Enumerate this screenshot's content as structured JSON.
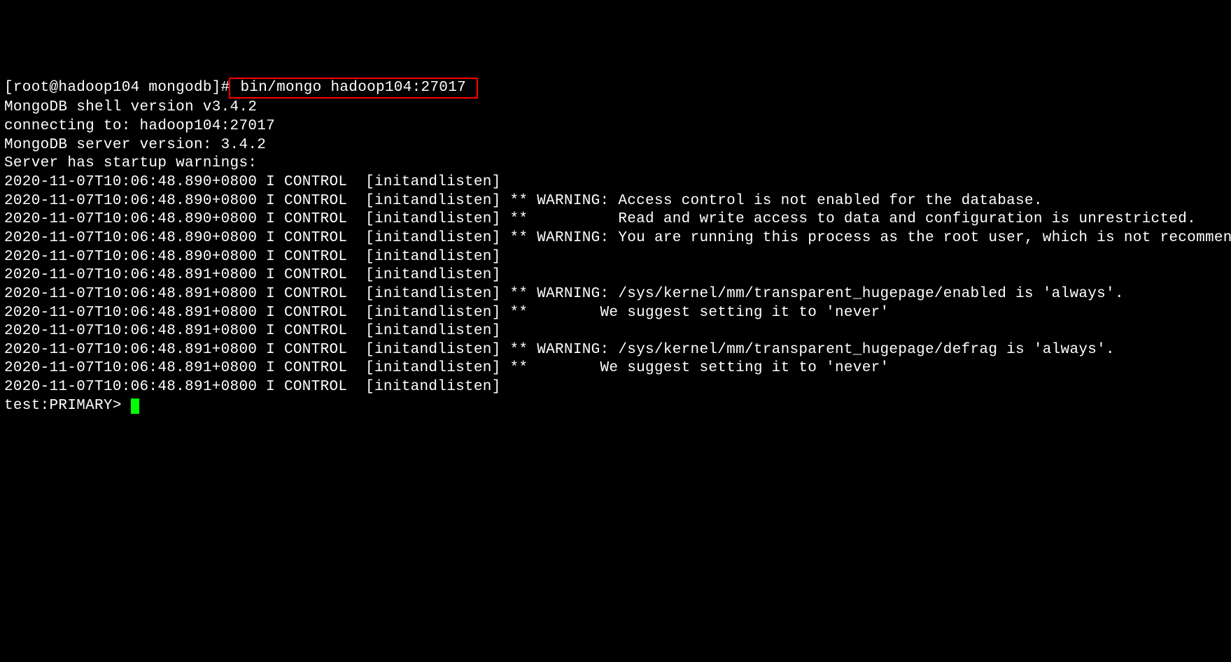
{
  "prompt_prefix": "[root@hadoop104 mongodb]#",
  "command": " bin/mongo hadoop104:27017 ",
  "lines": {
    "l1": "MongoDB shell version v3.4.2",
    "l2": "connecting to: hadoop104:27017",
    "l3": "MongoDB server version: 3.4.2",
    "l4": "Server has startup warnings: ",
    "l5": "2020-11-07T10:06:48.890+0800 I CONTROL  [initandlisten] ",
    "l6": "2020-11-07T10:06:48.890+0800 I CONTROL  [initandlisten] ** WARNING: Access control is not enabled for the database.",
    "l7": "2020-11-07T10:06:48.890+0800 I CONTROL  [initandlisten] **          Read and write access to data and configuration is unrestricted.",
    "l8": "2020-11-07T10:06:48.890+0800 I CONTROL  [initandlisten] ** WARNING: You are running this process as the root user, which is not recommended.",
    "l9": "2020-11-07T10:06:48.890+0800 I CONTROL  [initandlisten] ",
    "l10": "2020-11-07T10:06:48.891+0800 I CONTROL  [initandlisten] ",
    "l11": "2020-11-07T10:06:48.891+0800 I CONTROL  [initandlisten] ** WARNING: /sys/kernel/mm/transparent_hugepage/enabled is 'always'.",
    "l12": "2020-11-07T10:06:48.891+0800 I CONTROL  [initandlisten] **        We suggest setting it to 'never'",
    "l13": "2020-11-07T10:06:48.891+0800 I CONTROL  [initandlisten] ",
    "l14": "2020-11-07T10:06:48.891+0800 I CONTROL  [initandlisten] ** WARNING: /sys/kernel/mm/transparent_hugepage/defrag is 'always'.",
    "l15": "2020-11-07T10:06:48.891+0800 I CONTROL  [initandlisten] **        We suggest setting it to 'never'",
    "l16": "2020-11-07T10:06:48.891+0800 I CONTROL  [initandlisten] "
  },
  "shell_prompt": "test:PRIMARY> "
}
